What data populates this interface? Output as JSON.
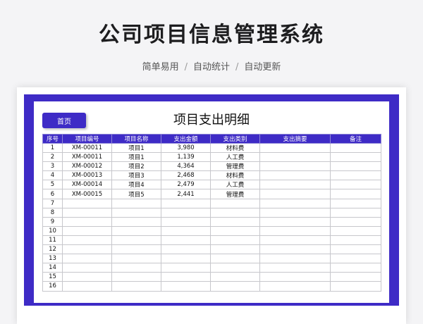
{
  "header": {
    "title": "公司项目信息管理系统",
    "subtitle_parts": [
      "简单易用",
      "自动统计",
      "自动更新"
    ]
  },
  "sheet": {
    "home_button": "首页",
    "title": "项目支出明细",
    "columns": [
      "序号",
      "项目编号",
      "项目名称",
      "支出金额",
      "支出类别",
      "支出摘要",
      "备注"
    ],
    "rows": [
      [
        "1",
        "XM-00011",
        "项目1",
        "3,980",
        "材料费",
        "",
        ""
      ],
      [
        "2",
        "XM-00011",
        "项目1",
        "1,139",
        "人工费",
        "",
        ""
      ],
      [
        "3",
        "XM-00012",
        "项目2",
        "4,364",
        "管理费",
        "",
        ""
      ],
      [
        "4",
        "XM-00013",
        "项目3",
        "2,468",
        "材料费",
        "",
        ""
      ],
      [
        "5",
        "XM-00014",
        "项目4",
        "2,479",
        "人工费",
        "",
        ""
      ],
      [
        "6",
        "XM-00015",
        "项目5",
        "2,441",
        "管理费",
        "",
        ""
      ],
      [
        "7",
        "",
        "",
        "",
        "",
        "",
        ""
      ],
      [
        "8",
        "",
        "",
        "",
        "",
        "",
        ""
      ],
      [
        "9",
        "",
        "",
        "",
        "",
        "",
        ""
      ],
      [
        "10",
        "",
        "",
        "",
        "",
        "",
        ""
      ],
      [
        "11",
        "",
        "",
        "",
        "",
        "",
        ""
      ],
      [
        "12",
        "",
        "",
        "",
        "",
        "",
        ""
      ],
      [
        "13",
        "",
        "",
        "",
        "",
        "",
        ""
      ],
      [
        "14",
        "",
        "",
        "",
        "",
        "",
        ""
      ],
      [
        "15",
        "",
        "",
        "",
        "",
        "",
        ""
      ],
      [
        "16",
        "",
        "",
        "",
        "",
        "",
        ""
      ]
    ]
  },
  "colors": {
    "accent": "#3e2bc6",
    "background": "#f4f4f6"
  }
}
